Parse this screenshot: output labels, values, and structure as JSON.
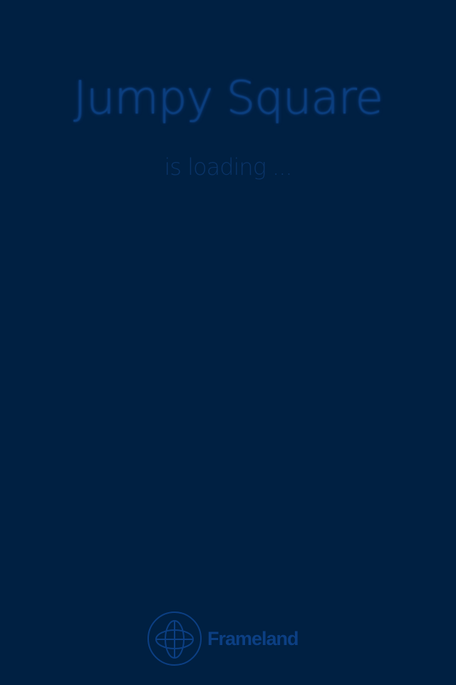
{
  "loading_screen": {
    "title": "Jumpy Square",
    "status": "is loading ..."
  },
  "brand": {
    "name": "Frameland",
    "logo_icon": "globe-orbit-icon"
  },
  "colors": {
    "background": "#002042",
    "title_text": "#0b3e7e",
    "status_text": "#0a3468",
    "brand": "#0c3f83"
  }
}
